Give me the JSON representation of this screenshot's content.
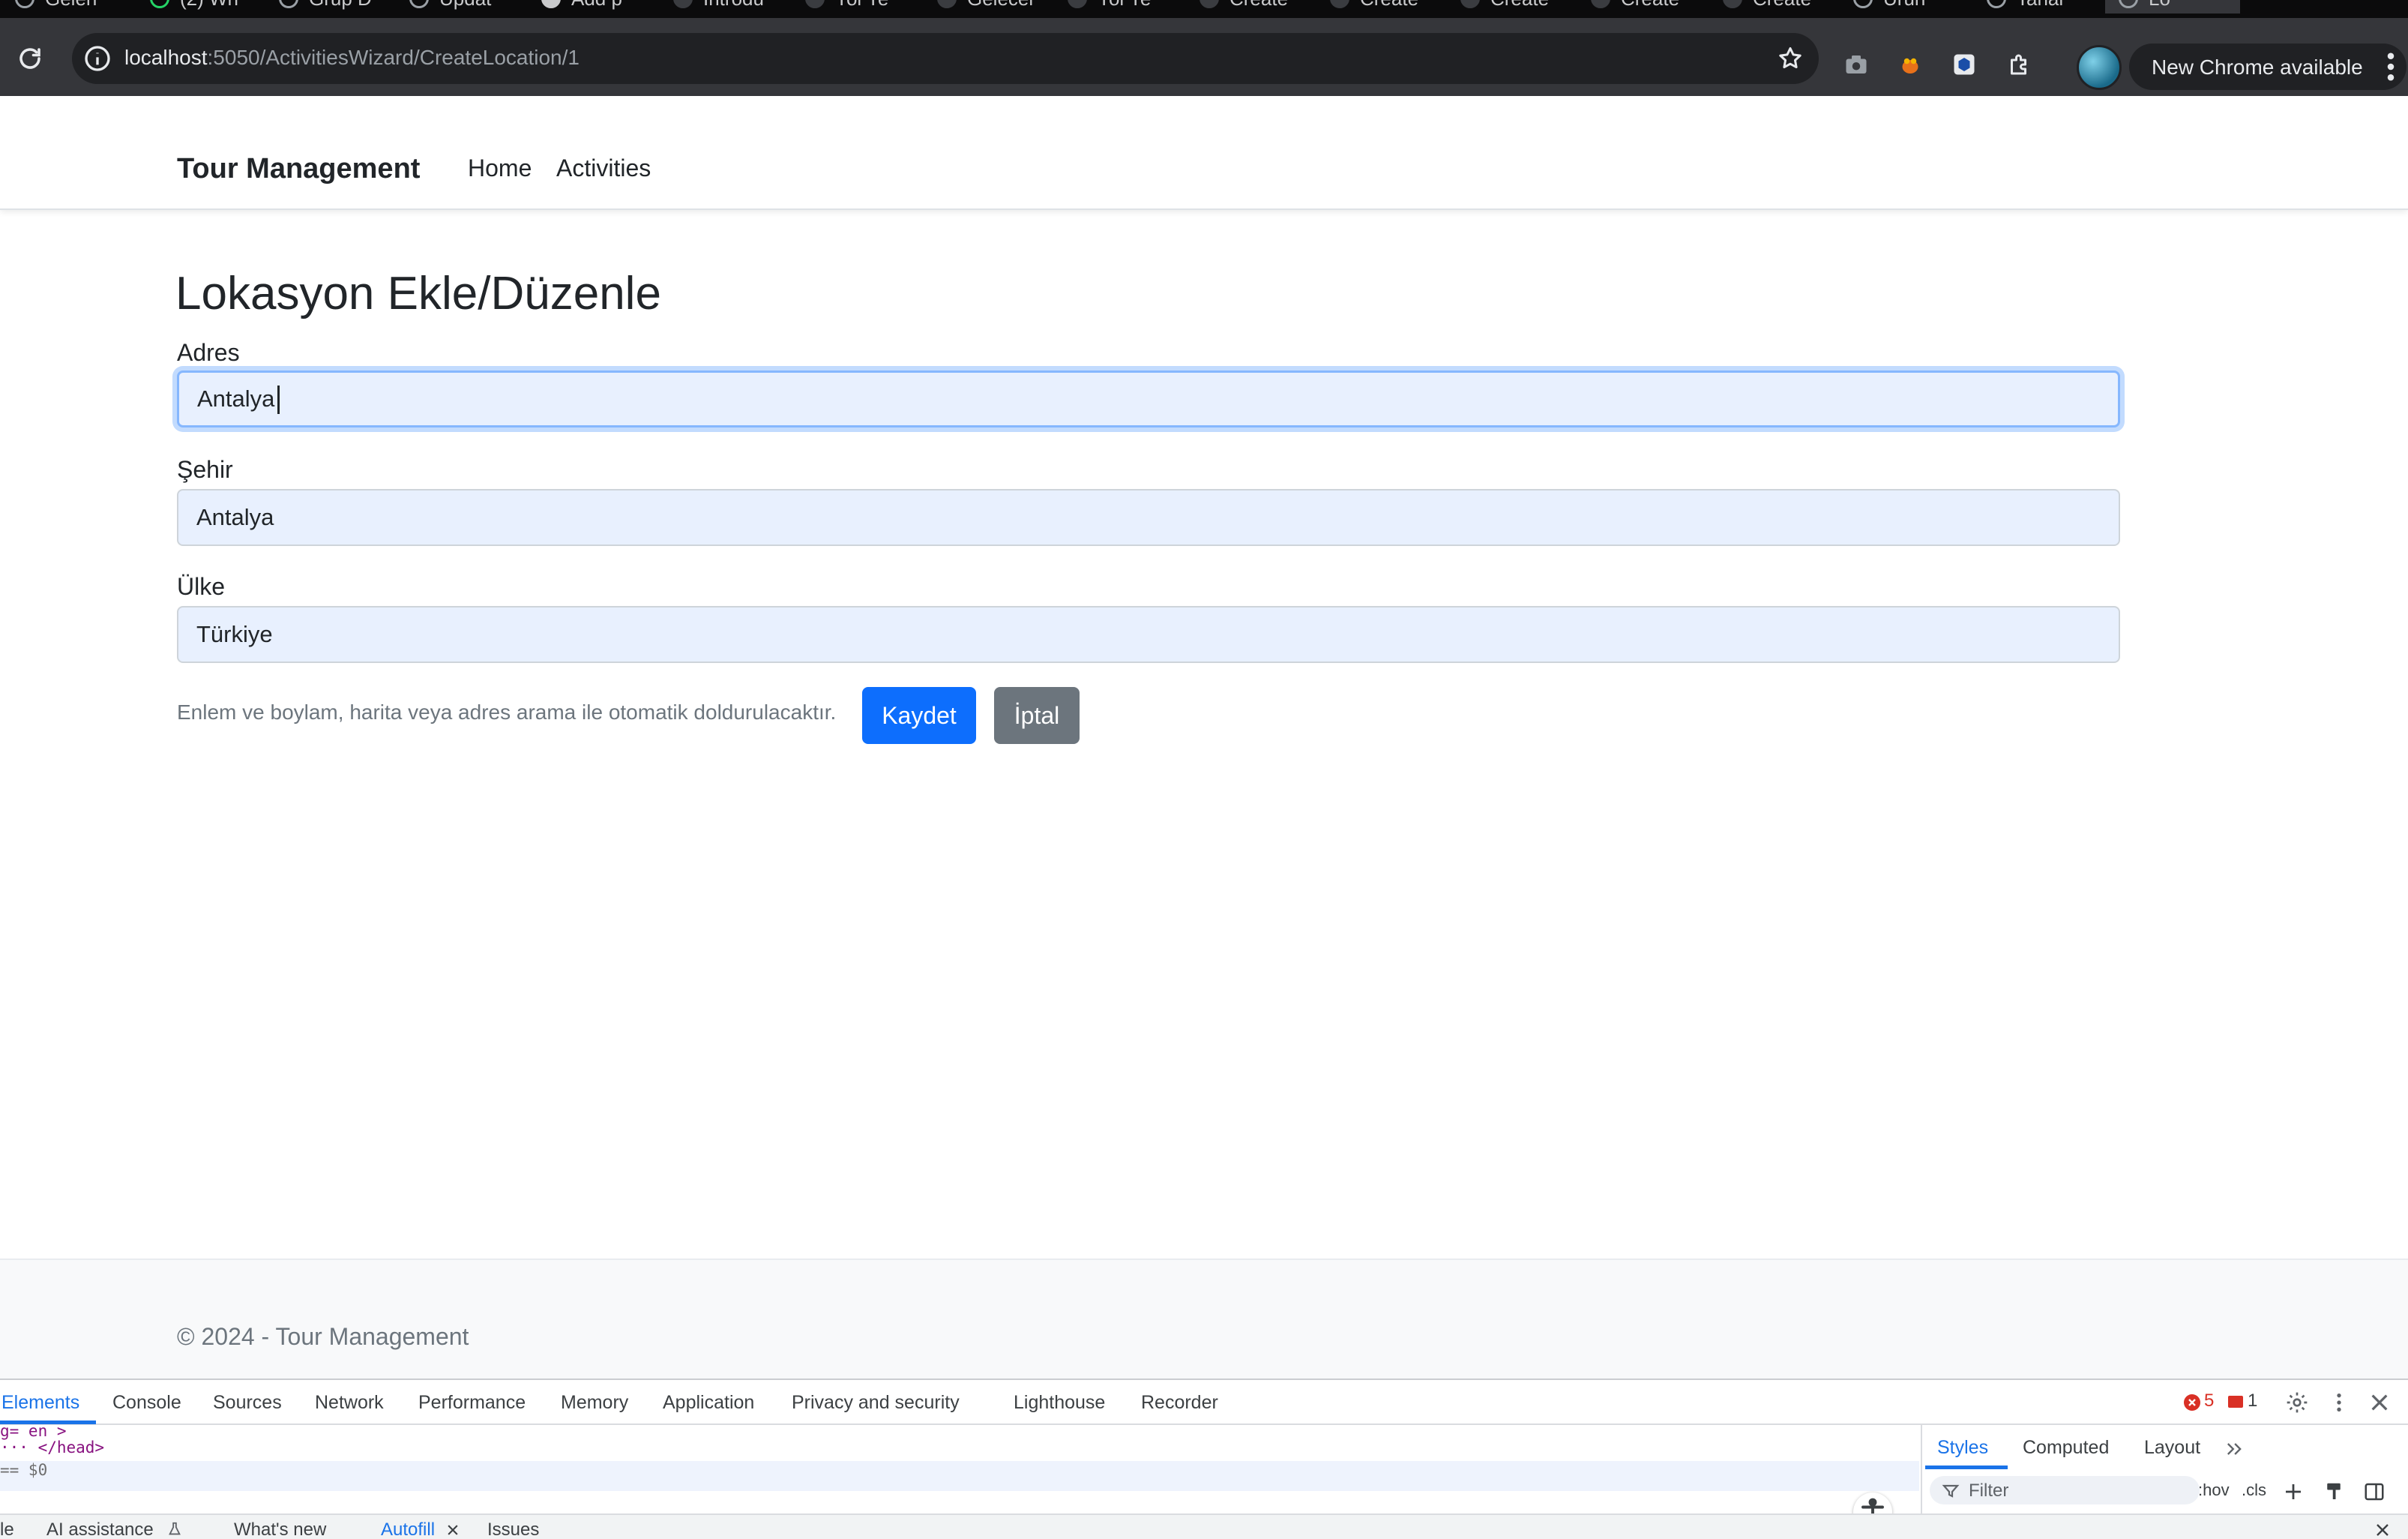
{
  "browser": {
    "tabs": [
      "Gelen",
      "(2) Wh",
      "Grup D",
      "Updat",
      "Add p",
      "Introdu",
      "Yol Ye",
      "Gelecel",
      "Yol Ye",
      "Create",
      "Create",
      "Create",
      "Create",
      "Create",
      "Ürün",
      "Tahar",
      "Lo"
    ],
    "address": {
      "host": "localhost",
      "port_path": ":5050/ActivitiesWizard/CreateLocation/1"
    },
    "update_label": "New Chrome available"
  },
  "nav": {
    "brand": "Tour Management",
    "links": [
      "Home",
      "Activities"
    ]
  },
  "form": {
    "title": "Lokasyon Ekle/Düzenle",
    "fields": [
      {
        "label": "Adres",
        "value": "Antalya"
      },
      {
        "label": "Şehir",
        "value": "Antalya"
      },
      {
        "label": "Ülke",
        "value": "Türkiye"
      }
    ],
    "hint": "Enlem ve boylam, harita veya adres arama ile otomatik doldurulacaktır.",
    "save_label": "Kaydet",
    "cancel_label": "İptal"
  },
  "footer": {
    "text": "© 2024 - Tour Management"
  },
  "devtools": {
    "tabs": [
      "Elements",
      "Console",
      "Sources",
      "Network",
      "Performance",
      "Memory",
      "Application",
      "Privacy and security",
      "Lighthouse",
      "Recorder"
    ],
    "error_count": "5",
    "warning_count": "1",
    "dom_lines": [
      "g= en >",
      "··· </head>",
      "== $0"
    ],
    "styles_tabs": [
      "Styles",
      "Computed",
      "Layout"
    ],
    "filter_placeholder": "Filter",
    "hov_label": ":hov",
    "cls_label": ".cls",
    "drawer_tabs": [
      "le",
      "AI assistance",
      "What's new",
      "Autofill",
      "Issues"
    ]
  }
}
